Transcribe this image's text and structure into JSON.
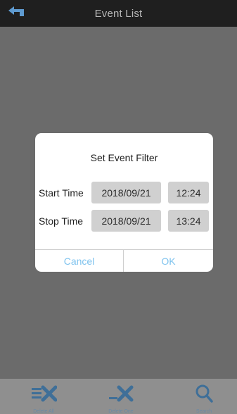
{
  "header": {
    "title": "Event List",
    "back_icon": "back-arrow-icon"
  },
  "dialog": {
    "title": "Set Event Filter",
    "start": {
      "label": "Start Time",
      "date": "2018/09/21",
      "time": "12:24"
    },
    "stop": {
      "label": "Stop Time",
      "date": "2018/09/21",
      "time": "13:24"
    },
    "cancel_label": "Cancel",
    "ok_label": "OK",
    "button_color": "#7fc3ee"
  },
  "toolbar": {
    "items": [
      {
        "label": "Delete All",
        "icon": "delete-all-icon"
      },
      {
        "label": "Delete One",
        "icon": "delete-one-icon"
      },
      {
        "label": "Search",
        "icon": "search-icon"
      }
    ]
  },
  "colors": {
    "header_bg": "#1f1f1f",
    "overlay_bg": "#6b6b6b",
    "toolbar_bg": "#8f8f8f",
    "icon_blue": "#3f6f98"
  }
}
